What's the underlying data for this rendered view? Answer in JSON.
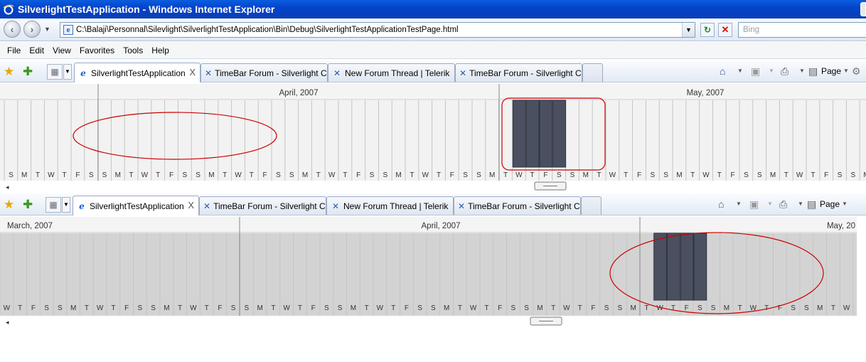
{
  "window": {
    "title": "SilverlightTestApplication - Windows Internet Explorer"
  },
  "address": {
    "url": "C:\\Balaji\\Personnal\\Silevlight\\SilverlightTestApplication\\Bin\\Debug\\SilverlightTestApplicationTestPage.html"
  },
  "search": {
    "placeholder": "Bing"
  },
  "menu": [
    "File",
    "Edit",
    "View",
    "Favorites",
    "Tools",
    "Help"
  ],
  "tabs": [
    {
      "label": "SilverlightTestApplication",
      "icon": "ie-icon",
      "active": true
    },
    {
      "label": "TimeBar Forum - Silverlight C...",
      "icon": "telerik-icon",
      "active": false
    },
    {
      "label": "New Forum Thread | Telerik",
      "icon": "telerik-icon",
      "active": false
    },
    {
      "label": "TimeBar Forum - Silverlight C...",
      "icon": "telerik-icon",
      "active": false
    }
  ],
  "toolbar_right": {
    "page_label": "Page"
  },
  "timebar1": {
    "months": [
      "April, 2007",
      "May, 2007"
    ],
    "days": [
      "S",
      "M",
      "T",
      "W",
      "T",
      "F",
      "S",
      "S",
      "M",
      "T",
      "W",
      "T",
      "F",
      "S",
      "S",
      "M",
      "T",
      "W",
      "T",
      "F",
      "S",
      "S",
      "M",
      "T",
      "W",
      "T",
      "F",
      "S",
      "S",
      "M",
      "T",
      "W",
      "T",
      "F",
      "S",
      "S",
      "M",
      "T",
      "W",
      "T",
      "F",
      "S",
      "S",
      "M",
      "T",
      "W",
      "T",
      "F",
      "S",
      "S",
      "M",
      "T",
      "W",
      "T",
      "F",
      "S",
      "S",
      "M",
      "T",
      "W",
      "T",
      "F",
      "S",
      "S",
      "M",
      "T",
      "W",
      "T",
      "F",
      "S",
      "S",
      "M",
      "T",
      "W",
      "T",
      "F",
      "S",
      "S",
      "M",
      "T",
      "W",
      "T",
      "F",
      "S",
      "S",
      "M",
      "T",
      "W",
      "T",
      "F",
      "S",
      "S",
      "M",
      "T",
      "W",
      "T",
      "F",
      "S",
      "S",
      "M"
    ],
    "background": "#f2f2f2"
  },
  "timebar2": {
    "months": [
      "March, 2007",
      "April, 2007",
      "May, 20"
    ],
    "days": [
      "W",
      "T",
      "F",
      "S",
      "S",
      "M",
      "T",
      "W",
      "T",
      "F",
      "S",
      "S",
      "M",
      "T",
      "W",
      "T",
      "F",
      "S",
      "S",
      "M",
      "T",
      "W",
      "T",
      "F",
      "S",
      "S",
      "M",
      "T",
      "W",
      "T",
      "F",
      "S",
      "S",
      "M",
      "T",
      "W",
      "T",
      "F",
      "S",
      "S",
      "M",
      "T",
      "W",
      "T",
      "F",
      "S",
      "S",
      "M",
      "T",
      "W",
      "T",
      "F",
      "S",
      "S",
      "M",
      "T",
      "W",
      "T",
      "F",
      "S",
      "S",
      "M",
      "T",
      "W",
      "T",
      "F",
      "S",
      "S",
      "M",
      "T",
      "W",
      "T",
      "F",
      "S",
      "S",
      "M",
      "T",
      "W",
      "T",
      "F",
      "S",
      "S",
      "M",
      "T",
      "W",
      "T",
      "F",
      "S",
      "S",
      "M",
      "T",
      "W",
      "T",
      "F",
      "S",
      "S",
      "M",
      "T",
      "W",
      "T",
      "F",
      "S",
      "S",
      "M",
      "T",
      "W"
    ],
    "background": "#d3d3d3"
  },
  "colors": {
    "selection": "#4a5060",
    "annotation": "#cc0000",
    "titlebar": "#0a4fd2"
  }
}
